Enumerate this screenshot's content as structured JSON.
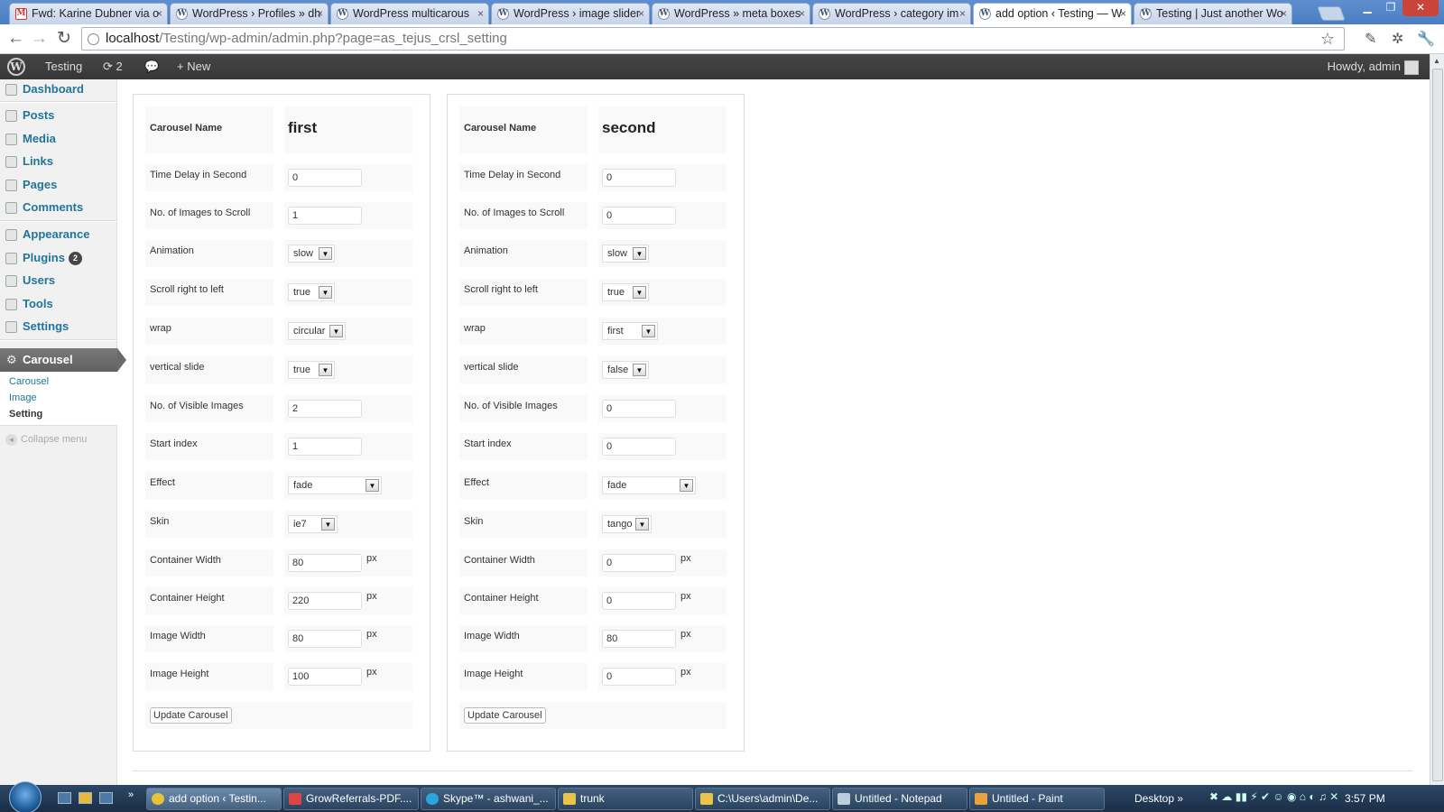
{
  "browser": {
    "tabs": [
      {
        "label": "Fwd: Karine Dubner via o",
        "icon": "gmail-icon"
      },
      {
        "label": "WordPress › Profiles » dh",
        "icon": "wordpress-icon"
      },
      {
        "label": "WordPress multicarous",
        "icon": "wordpress-icon"
      },
      {
        "label": "WordPress › image slider",
        "icon": "wordpress-icon"
      },
      {
        "label": "WordPress » meta boxes",
        "icon": "wordpress-icon"
      },
      {
        "label": "WordPress › category im",
        "icon": "wordpress-icon"
      },
      {
        "label": "add option ‹ Testing — W",
        "icon": "wordpress-icon",
        "active": true
      },
      {
        "label": "Testing | Just another Wo",
        "icon": "wordpress-icon"
      }
    ],
    "url_host": "localhost",
    "url_path": "/Testing/wp-admin/admin.php?page=as_tejus_crsl_setting"
  },
  "adminbar": {
    "site_name": "Testing",
    "updates_count": "2",
    "new_label": "New",
    "howdy": "Howdy, admin"
  },
  "sidebar": {
    "items": [
      {
        "label": "Dashboard",
        "icon": "dashboard-icon"
      },
      {
        "label": "Posts",
        "icon": "pin-icon"
      },
      {
        "label": "Media",
        "icon": "media-icon"
      },
      {
        "label": "Links",
        "icon": "link-icon"
      },
      {
        "label": "Pages",
        "icon": "page-icon"
      },
      {
        "label": "Comments",
        "icon": "comment-icon"
      },
      {
        "label": "Appearance",
        "icon": "appearance-icon"
      },
      {
        "label": "Plugins",
        "icon": "plugin-icon",
        "badge": "2"
      },
      {
        "label": "Users",
        "icon": "users-icon"
      },
      {
        "label": "Tools",
        "icon": "tools-icon"
      },
      {
        "label": "Settings",
        "icon": "settings-icon"
      }
    ],
    "current_menu": "Carousel",
    "submenu": [
      "Carousel",
      "Image",
      "Setting"
    ],
    "collapse_label": "Collapse menu"
  },
  "form_labels": {
    "carousel_name": "Carousel Name",
    "time_delay": "Time Delay in Second",
    "images_to_scroll": "No. of Images to Scroll",
    "animation": "Animation",
    "scroll_rtl": "Scroll right to left",
    "wrap": "wrap",
    "vertical": "vertical slide",
    "visible_images": "No. of Visible Images",
    "start_index": "Start index",
    "effect": "Effect",
    "skin": "Skin",
    "container_width": "Container Width",
    "container_height": "Container Height",
    "image_width": "Image Width",
    "image_height": "Image Height",
    "px_unit": "px",
    "update_button": "Update Carousel"
  },
  "carousels": [
    {
      "name": "first",
      "time_delay": "0",
      "images_to_scroll": "1",
      "animation": "slow",
      "scroll_rtl": "true",
      "wrap": "circular",
      "vertical": "true",
      "visible_images": "2",
      "start_index": "1",
      "effect": "fade",
      "skin": "ie7",
      "container_width": "80",
      "container_height": "220",
      "image_width": "80",
      "image_height": "100"
    },
    {
      "name": "second",
      "time_delay": "0",
      "images_to_scroll": "0",
      "animation": "slow",
      "scroll_rtl": "true",
      "wrap": "first",
      "vertical": "false",
      "visible_images": "0",
      "start_index": "0",
      "effect": "fade",
      "skin": "tango",
      "container_width": "0",
      "container_height": "0",
      "image_width": "80",
      "image_height": "0"
    }
  ],
  "taskbar": {
    "items": [
      {
        "label": "add option ‹ Testin...",
        "active": true
      },
      {
        "label": "GrowReferrals-PDF...."
      },
      {
        "label": "Skype™ - ashwani_..."
      },
      {
        "label": "trunk"
      },
      {
        "label": "C:\\Users\\admin\\De..."
      },
      {
        "label": "Untitled - Notepad"
      },
      {
        "label": "Untitled - Paint"
      }
    ],
    "desktop_label": "Desktop",
    "clock": "3:57 PM"
  }
}
